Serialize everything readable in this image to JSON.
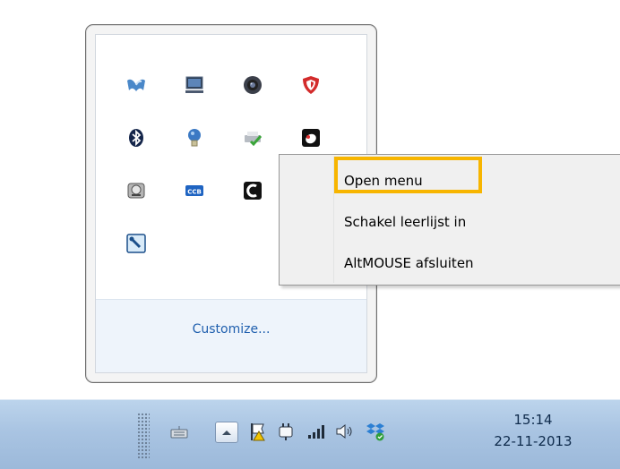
{
  "flyout": {
    "icons": [
      {
        "name": "network-wing-icon"
      },
      {
        "name": "laptop-screen-icon"
      },
      {
        "name": "webcam-icon"
      },
      {
        "name": "security-shield-icon"
      },
      {
        "name": "bluetooth-icon"
      },
      {
        "name": "lightbulb-icon"
      },
      {
        "name": "printer-check-icon"
      },
      {
        "name": "mouse-app-icon"
      },
      {
        "name": "disk-drive-icon"
      },
      {
        "name": "ccb-card-icon"
      },
      {
        "name": "c-logo-icon"
      },
      {
        "name": "wrench-tool-icon"
      }
    ],
    "customize_label": "Customize..."
  },
  "context_menu": {
    "items": [
      {
        "label": "Open menu"
      },
      {
        "label": "Schakel leerlijst in"
      },
      {
        "label": "AltMOUSE afsluiten"
      }
    ],
    "highlight_color": "#f7b500"
  },
  "taskbar": {
    "clock_time": "15:14",
    "clock_date": "22-11-2013",
    "icons": [
      {
        "name": "keyboard-icon"
      },
      {
        "name": "show-hidden-icons-button"
      },
      {
        "name": "action-center-flag-icon"
      },
      {
        "name": "power-plug-icon"
      },
      {
        "name": "network-signal-icon"
      },
      {
        "name": "volume-icon"
      },
      {
        "name": "dropbox-sync-icon"
      }
    ]
  }
}
